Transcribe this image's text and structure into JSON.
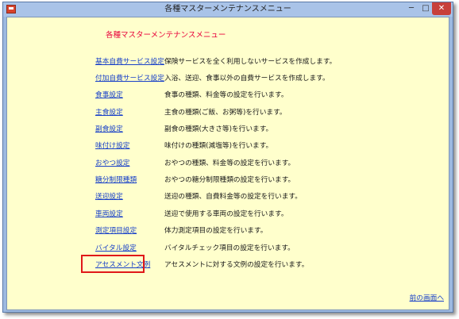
{
  "window": {
    "title": "各種マスターメンテナンスメニュー",
    "minimize_glyph": "─",
    "maximize_glyph": "□",
    "close_glyph": "✕",
    "app_icon": "app-icon"
  },
  "header": {
    "title": "各種マスターメンテナンスメニュー"
  },
  "menu": {
    "items": [
      {
        "label": "基本自費サービス設定",
        "description": "保険サービスを全く利用しないサービスを作成します。"
      },
      {
        "label": "付加自費サービス設定",
        "description": "入浴、送迎、食事以外の自費サービスを作成します。"
      },
      {
        "label": "食事設定",
        "description": "食事の種類、料金等の設定を行います。"
      },
      {
        "label": "主食設定",
        "description": "主食の種類(ご飯、お粥等)を行います。"
      },
      {
        "label": "副食設定",
        "description": "副食の種類(大きさ等)を行います。"
      },
      {
        "label": "味付け設定",
        "description": "味付けの種類(減塩等)を行います。"
      },
      {
        "label": "おやつ設定",
        "description": "おやつの種類、料金等の設定を行います。"
      },
      {
        "label": "糖分制限種類",
        "description": "おやつの糖分制限種類の設定を行います。"
      },
      {
        "label": "送迎設定",
        "description": "送迎の種類、自費料金等の設定を行います。"
      },
      {
        "label": "車両設定",
        "description": "送迎で使用する車両の設定を行います。"
      },
      {
        "label": "測定項目設定",
        "description": "体力測定項目の設定を行います。"
      },
      {
        "label": "バイタル設定",
        "description": "バイタルチェック項目の設定を行います。"
      },
      {
        "label": "アセスメント文例",
        "description": "アセスメントに対する文例の設定を行います。"
      }
    ]
  },
  "footer": {
    "back_label": "前の画面へ"
  },
  "colors": {
    "background": "#ffffcc",
    "link": "#1840c8",
    "header": "#e8003a",
    "highlight": "#e01818",
    "titlebar": "#a9c3e8"
  }
}
